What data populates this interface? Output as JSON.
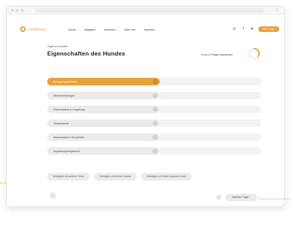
{
  "header": {
    "brand": "vierbeiner",
    "menu": [
      "Suche",
      "Ratgeber",
      "Adressen",
      "Über uns",
      "Spenden"
    ],
    "cta_label": "Mein Konto"
  },
  "main": {
    "breadcrumb": "Angebot einstellen",
    "title": "Eigenschaften des Hundes",
    "progress_text": "6 von 17 Fragen beantwortet",
    "progress_fraction": 0.35
  },
  "categories": [
    {
      "label": "Bewegungsbedürfnis",
      "active": true
    },
    {
      "label": "Menschenbezogen",
      "active": false
    },
    {
      "label": "Platzbedarfnis & Umgebung",
      "active": false
    },
    {
      "label": "Temperament",
      "active": false
    },
    {
      "label": "Wachsamkeit & Schutztrieb",
      "active": false
    },
    {
      "label": "Anpassungsmöglichkeit",
      "active": false
    }
  ],
  "chips": [
    "Verträglich mit anderen Tieren",
    "Verträglich mit kleinen Kindern",
    "Verträglich mit Kinder ergänzen Arbeit"
  ],
  "footer": {
    "next_label": "Nächste Frage",
    "accent": "#e6a23c"
  }
}
